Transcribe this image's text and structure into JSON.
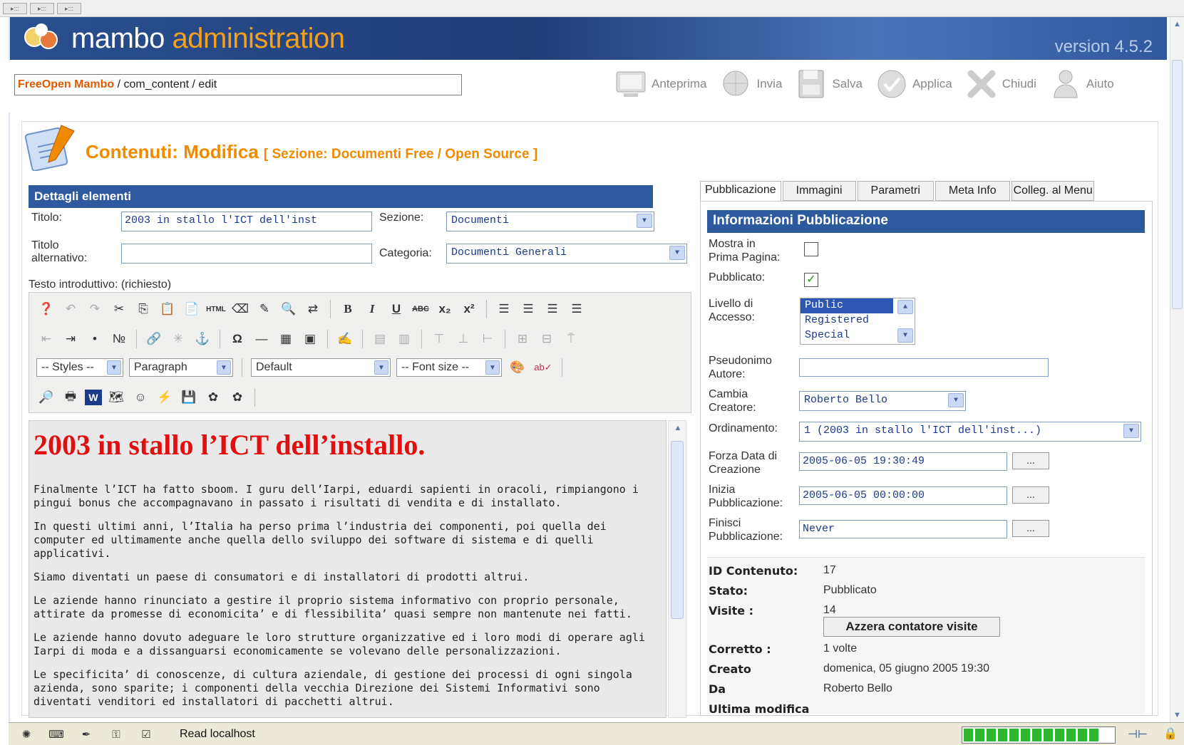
{
  "top_strip": [
    "▸:::",
    "▸:::",
    "▸:::"
  ],
  "header": {
    "brand_a": "mambo",
    "brand_b": "administration",
    "version": "version 4.5.2"
  },
  "path": {
    "site": "FreeOpen Mambo",
    "rest": "/ com_content / edit"
  },
  "toolbar": {
    "preview": "Anteprima",
    "send": "Invia",
    "save": "Salva",
    "apply": "Applica",
    "close": "Chiudi",
    "help": "Aiuto"
  },
  "page": {
    "title_a": "Contenuti:",
    "title_b": "Modifica",
    "section_label": "[ Sezione: Documenti Free / Open Source ]"
  },
  "details": {
    "heading": "Dettagli elementi",
    "title_label": "Titolo:",
    "title_value": "2003 in stallo l'ICT dell'inst",
    "section_label": "Sezione:",
    "section_value": "Documenti",
    "alt_title_label_1": "Titolo",
    "alt_title_label_2": "alternativo:",
    "alt_title_value": "",
    "category_label": "Categoria:",
    "category_value": "Documenti Generali",
    "intro_label": "Testo introduttivo: (richiesto)"
  },
  "editor": {
    "styles": "-- Styles --",
    "format": "Paragraph",
    "font": "Default",
    "font_size": "-- Font size --",
    "html_label": "HTML",
    "heading": "2003 in stallo l’ICT dell’installo.",
    "paragraphs": [
      "Finalmente l’ICT ha fatto sboom. I guru dell’Iarpi, eduardi sapienti in oracoli, rimpiangono i pingui bonus che accompagnavano in passato i risultati di vendita e di installato.",
      "In questi ultimi anni, l’Italia ha perso prima l’industria dei componenti, poi quella dei computer ed ultimamente anche quella dello sviluppo dei software di sistema e di quelli applicativi.",
      "Siamo diventati un paese di consumatori e di installatori di prodotti altrui.",
      "Le aziende hanno rinunciato a gestire il proprio sistema informativo con proprio personale, attirate da promesse di economicita’ e di flessibilita’ quasi sempre non mantenute nei fatti.",
      "Le aziende hanno dovuto adeguare le loro strutture organizzative ed i loro modi di operare agli Iarpi di moda e a dissanguarsi economicamente se volevano delle personalizzazioni.",
      "Le specificita’ di conoscenze, di cultura aziendale, di gestione dei processi di ogni singola azienda, sono sparite; i componenti della vecchia Direzione dei Sistemi Informativi sono diventati venditori ed installatori di pacchetti altrui."
    ]
  },
  "tabs": [
    "Pubblicazione",
    "Immagini",
    "Parametri",
    "Meta Info",
    "Colleg. al Menu"
  ],
  "publish": {
    "heading": "Informazioni Pubblicazione",
    "frontpage_label_1": "Mostra in",
    "frontpage_label_2": "Prima Pagina:",
    "published_label": "Pubblicato:",
    "published_check": "✓",
    "access_label_1": "Livello di",
    "access_label_2": "Accesso:",
    "access_options": [
      "Public",
      "Registered",
      "Special"
    ],
    "alias_label_1": "Pseudonimo",
    "alias_label_2": "Autore:",
    "alias_value": "",
    "creator_label_1": "Cambia",
    "creator_label_2": "Creatore:",
    "creator_value": "Roberto Bello",
    "order_label": "Ordinamento:",
    "order_value": "1 (2003 in stallo l'ICT dell'inst...)",
    "created_label_1": "Forza Data di",
    "created_label_2": "Creazione",
    "created_value": "2005-06-05 19:30:49",
    "start_label_1": "Inizia",
    "start_label_2": "Pubblicazione:",
    "start_value": "2005-06-05 00:00:00",
    "end_label_1": "Finisci",
    "end_label_2": "Pubblicazione:",
    "end_value": "Never",
    "dots": "..."
  },
  "info": {
    "id_label": "ID Contenuto:",
    "id_value": "17",
    "state_label": "Stato:",
    "state_value": "Pubblicato",
    "visits_label": "Visite :",
    "visits_value": "14",
    "reset_button": "Azzera contatore visite",
    "revised_label": "Corretto :",
    "revised_value": "1 volte",
    "created_label": "Creato",
    "created_value": "domenica, 05 giugno 2005 19:30",
    "by_label": "Da",
    "by_value": "Roberto Bello",
    "modified_label": "Ultima modifica"
  },
  "status": {
    "text": "Read localhost",
    "progress_segments": 12
  },
  "colors": {
    "header_blue": "#2a4f8f",
    "accent_orange": "#f08a00",
    "section_blue": "#2d5a9e",
    "editor_heading_red": "#e01010"
  }
}
